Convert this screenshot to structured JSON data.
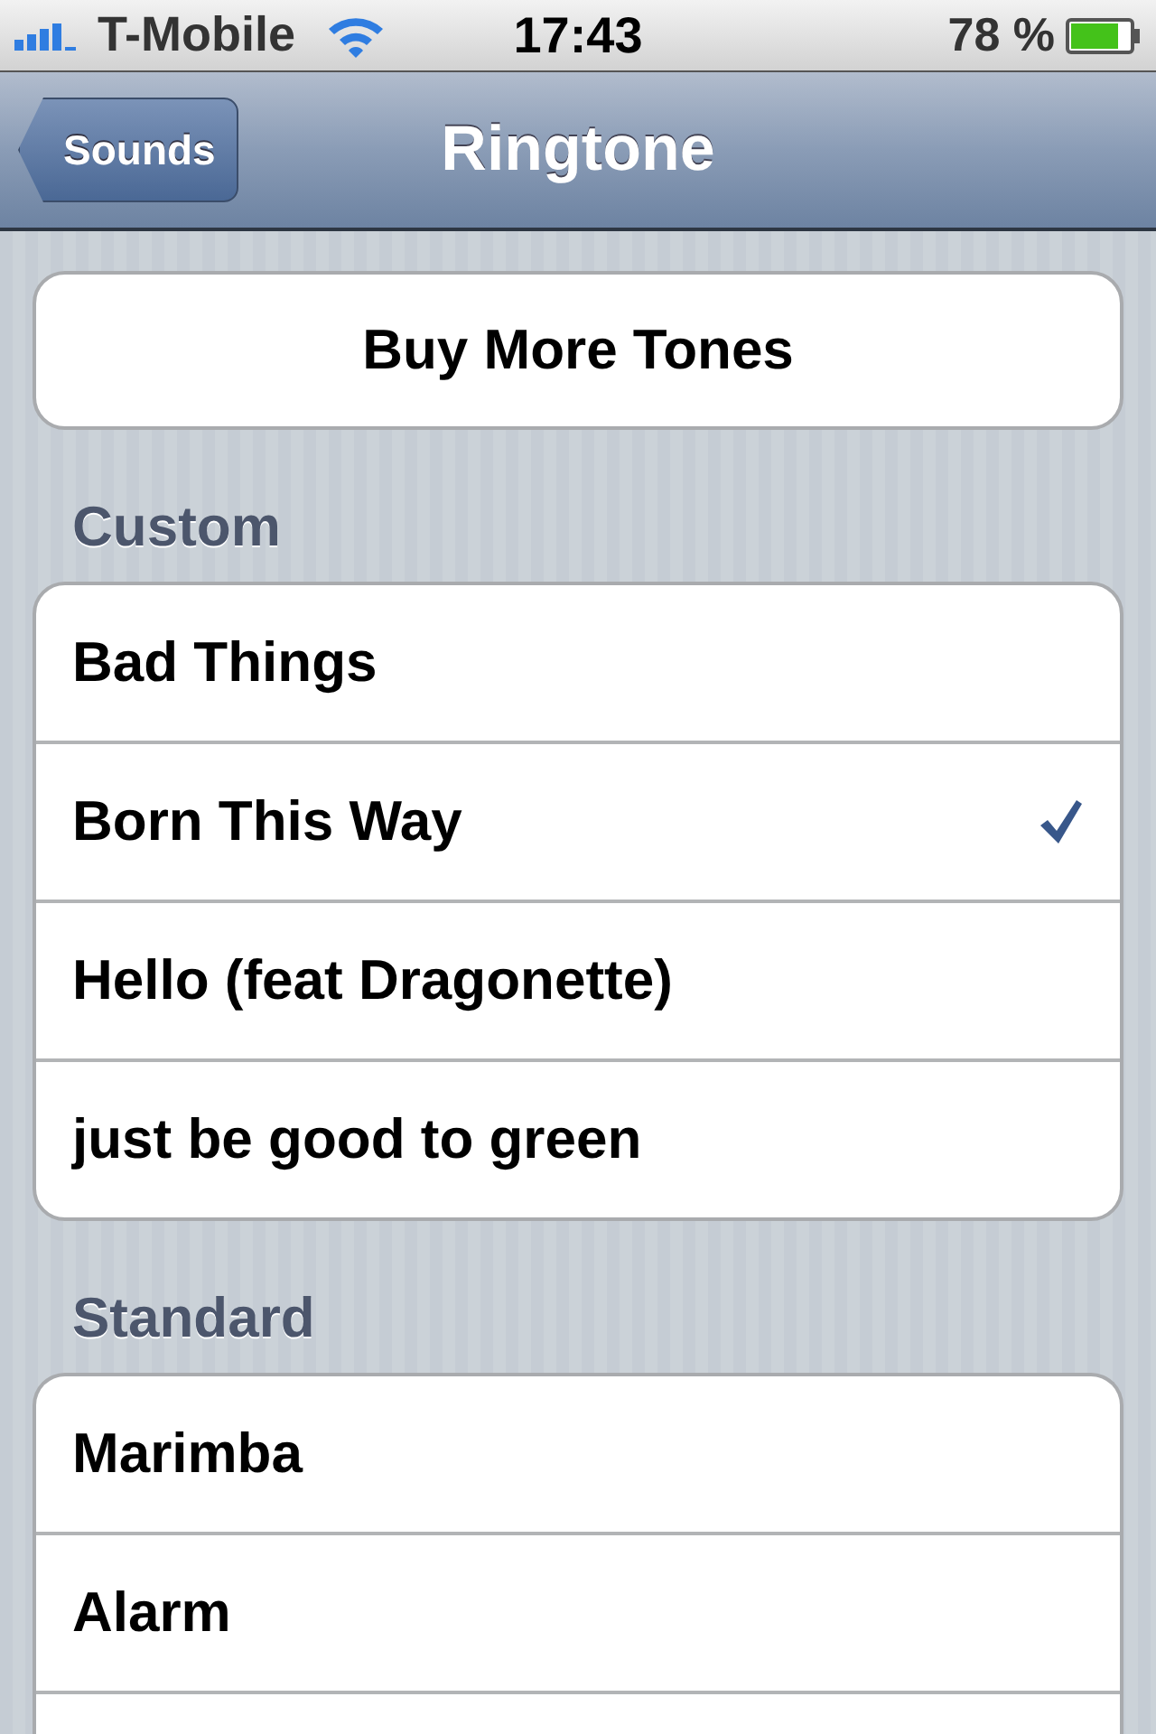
{
  "status_bar": {
    "carrier": "T-Mobile",
    "time": "17:43",
    "battery": "78 %"
  },
  "nav_bar": {
    "back": "Sounds",
    "title": "Ringtone"
  },
  "buy_button": "Buy More Tones",
  "sections": [
    {
      "header": "Custom",
      "items": [
        {
          "label": "Bad Things",
          "selected": false
        },
        {
          "label": "Born This Way",
          "selected": true
        },
        {
          "label": "Hello (feat Dragonette)",
          "selected": false
        },
        {
          "label": "just be good to green",
          "selected": false
        }
      ],
      "continues": false
    },
    {
      "header": "Standard",
      "items": [
        {
          "label": "Marimba",
          "selected": false
        },
        {
          "label": "Alarm",
          "selected": false
        }
      ],
      "continues": true
    }
  ]
}
